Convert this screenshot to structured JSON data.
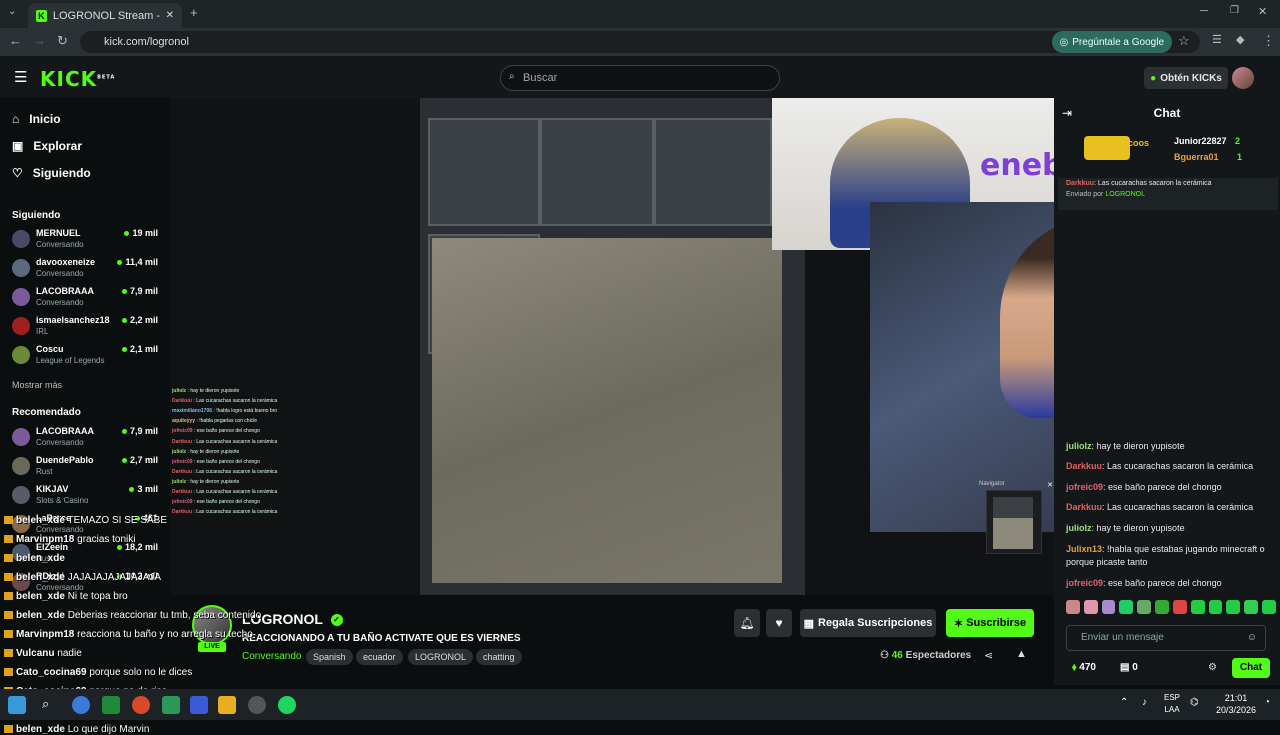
{
  "browser": {
    "tab_title": "LOGRONOL Stream - Watch Li",
    "url": "kick.com/logronol",
    "google_prompt": "Pregúntale a Google"
  },
  "header": {
    "logo": "KICK",
    "logo_badge": "BETA",
    "search_placeholder": "Buscar",
    "kicks_button": "Obtén KICKs"
  },
  "sidebar": {
    "nav": [
      {
        "label": "Inicio",
        "icon": "home-icon"
      },
      {
        "label": "Explorar",
        "icon": "compass-icon"
      },
      {
        "label": "Siguiendo",
        "icon": "heart-icon"
      }
    ],
    "following_title": "Siguiendo",
    "following": [
      {
        "name": "MERNUEL",
        "category": "Conversando",
        "viewers": "19 mil",
        "color": "#4a4a66"
      },
      {
        "name": "davooxeneize",
        "category": "Conversando",
        "viewers": "11,4 mil",
        "color": "#5a6a7a"
      },
      {
        "name": "LACOBRAAA",
        "category": "Conversando",
        "viewers": "7,9 mil",
        "color": "#7a5a9a"
      },
      {
        "name": "ismaelsanchez18",
        "category": "IRL",
        "viewers": "2,2 mil",
        "color": "#a02020"
      },
      {
        "name": "Coscu",
        "category": "League of Legends",
        "viewers": "2,1 mil",
        "color": "#6a8a3a"
      }
    ],
    "show_more": "Mostrar más",
    "recommended_title": "Recomendado",
    "recommended": [
      {
        "name": "LACOBRAAA",
        "category": "Conversando",
        "viewers": "7,9 mil",
        "color": "#7a5a9a"
      },
      {
        "name": "DuendePablo",
        "category": "Rust",
        "viewers": "2,7 mil",
        "color": "#6a6a5a"
      },
      {
        "name": "KIKJAV",
        "category": "Slots & Casino",
        "viewers": "3 mil",
        "color": "#5a5a6a"
      },
      {
        "name": "LaParce",
        "category": "Conversando",
        "viewers": "461",
        "color": "#8a6a4a"
      },
      {
        "name": "ElZeein",
        "category": "Rust",
        "viewers": "18,2 mil",
        "color": "#4a5a6a"
      },
      {
        "name": "RDiayi",
        "category": "Conversando",
        "viewers": "14,2 mil",
        "color": "#6a4a4a"
      }
    ]
  },
  "video_chat_overlay": [
    {
      "user": "julioIz",
      "text": "hay te dieron yupisote",
      "color": "#9be07a"
    },
    {
      "user": "Darkkuu",
      "text": "Las cucarachas sacaron la cerámica",
      "color": "#e06060"
    },
    {
      "user": "maximiliano1706",
      "text": "!habla logro está bueno bro",
      "color": "#7ac0e0"
    },
    {
      "user": "aquiteyyy",
      "text": "!habla pegarlas con chicle",
      "color": "#e0c070"
    },
    {
      "user": "jofreic09",
      "text": "ese baño parece del chongo",
      "color": "#e06080"
    },
    {
      "user": "Darkkuu",
      "text": "Las cucarachas sacaron la cerámica",
      "color": "#e06060"
    },
    {
      "user": "julioIz",
      "text": "hay te dieron yupisote",
      "color": "#9be07a"
    },
    {
      "user": "jofreic09",
      "text": "ese baño parece del chongo",
      "color": "#e06080"
    },
    {
      "user": "Darkkuu",
      "text": "Las cucarachas sacaron la cerámica",
      "color": "#e06060"
    },
    {
      "user": "julioIz",
      "text": "hay te dieron yupisote",
      "color": "#9be07a"
    },
    {
      "user": "Darkkuu",
      "text": "Las cucarachas sacaron la cerámica",
      "color": "#e06060"
    },
    {
      "user": "jofreic09",
      "text": "ese baño parece del chongo",
      "color": "#e06080"
    },
    {
      "user": "Darkkuu",
      "text": "Las cucarachas sacaron la cerámica",
      "color": "#e06060"
    }
  ],
  "navigator_label": "Navigator",
  "overlay_chat": [
    {
      "user": "belen_xde",
      "text": "TEMAZO SI SE SABE"
    },
    {
      "user": "Marvinpm18",
      "text": "gracias toniki"
    },
    {
      "user": "belen_xde",
      "text": ""
    },
    {
      "user": "belen_xde",
      "text": "JAJAJAJAJAJAJAJA"
    },
    {
      "user": "belen_xde",
      "text": "Ni te topa bro"
    },
    {
      "user": "belen_xde",
      "text": "Deberias reaccionar tu tmb, seba contenido"
    },
    {
      "user": "Marvinpm18",
      "text": "reacciona tu baño y no arregla su techo"
    },
    {
      "user": "Vulcanu",
      "text": "nadie"
    },
    {
      "user": "Cato_cocina69",
      "text": "porque solo no le dices"
    },
    {
      "user": "Cato_cocina69",
      "text": "porque no da risa"
    },
    {
      "user": "belen_xde",
      "text": "Siiii"
    },
    {
      "user": "belen_xde",
      "text": "Lo que dijo Marvin"
    }
  ],
  "stream": {
    "name": "LOGRONOL",
    "title": "REACCIONANDO A TU BAÑO ACTIVATE QUE ES VIERNES",
    "category": "Conversando",
    "tags": [
      "Spanish",
      "ecuador",
      "LOGRONOL",
      "chatting"
    ],
    "gift_button": "Regala Suscripciones",
    "subscribe_button": "Suscribirse",
    "viewers": "46",
    "viewers_label": "Espectadores",
    "live_badge": "LIVE"
  },
  "chat": {
    "title": "Chat",
    "leaderboard": [
      {
        "user": "Maarccoos",
        "value": ""
      },
      {
        "user": "Junior22827",
        "value": "2"
      },
      {
        "user": "Bguerra01",
        "value": "1"
      }
    ],
    "pinned_preview": {
      "user": "Darkkuu",
      "text": "Las cucarachas sacaron la cerámica",
      "sent_by": "Enviado por",
      "sender": "LOGRONOL"
    },
    "messages": [
      {
        "user": "julioIz",
        "text": "hay te dieron yupisote",
        "color": "#9be07a"
      },
      {
        "user": "Darkkuu",
        "text": "Las cucarachas sacaron la cerámica",
        "color": "#e06060"
      },
      {
        "user": "jofreic09",
        "text": "ese baño parece del chongo",
        "color": "#e06080"
      },
      {
        "user": "Darkkuu",
        "text": "Las cucarachas sacaron la cerámica",
        "color": "#e06060"
      },
      {
        "user": "julioIz",
        "text": "hay te dieron yupisote",
        "color": "#9be07a"
      },
      {
        "user": "Julixn13",
        "text": "!habla que estabas jugando minecraft o porque picaste tanto",
        "color": "#e0a040"
      },
      {
        "user": "jofreic09",
        "text": "ese baño parece del chongo",
        "color": "#e06080"
      }
    ],
    "input_placeholder": "Enviar un mensaje",
    "points": "470",
    "store_count": "0",
    "send_button": "Chat"
  },
  "taskbar": {
    "lang_top": "ESP",
    "lang_bottom": "LAA",
    "time": "21:01",
    "date": "20/3/2026"
  },
  "colors": {
    "kick_green": "#53fc18",
    "background": "#0b0e0f"
  }
}
